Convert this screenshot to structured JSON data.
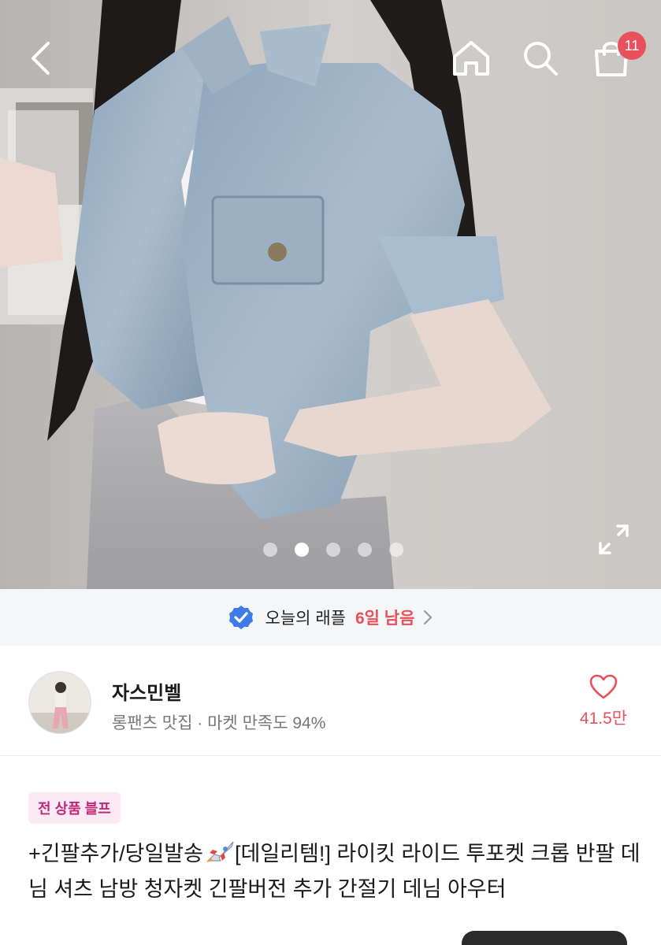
{
  "header": {
    "back_icon": "chevron-left-icon",
    "home_icon": "home-icon",
    "search_icon": "search-icon",
    "bag_icon": "shopping-bag-icon",
    "cart_badge": "11"
  },
  "gallery": {
    "total_images": 5,
    "active_index": 2,
    "expand_icon": "expand-icon"
  },
  "raffle": {
    "label": "오늘의 래플",
    "remaining": "6일 남음",
    "icon": "verified-check-icon"
  },
  "seller": {
    "name": "자스민벨",
    "subtitle": "롱팬츠 맛집 · 마켓 만족도 94%",
    "favorite_count": "41.5만"
  },
  "product": {
    "tag": "전 상품 블프",
    "title_before_emoji": "+긴팔추가/당일발송",
    "title_after_emoji": "[데일리템!] 라이킷 라이드 투포켓 크롭 반팔 데님 셔츠 남방 청자켓 긴팔버전 추가 간절기 데님 아우터"
  },
  "colors": {
    "accent_red": "#e8505b",
    "tag_pink": "#c0287a",
    "verified_blue": "#3d7ce6"
  }
}
